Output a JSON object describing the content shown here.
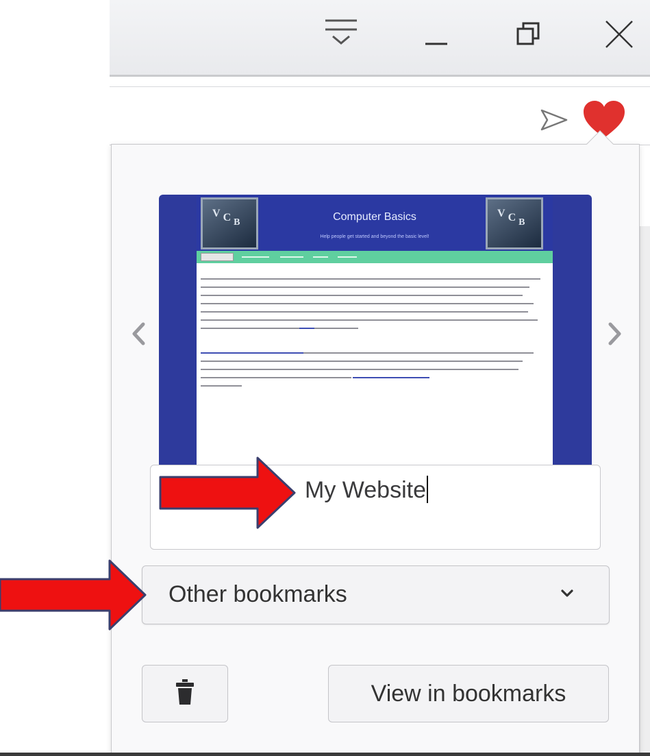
{
  "colors": {
    "accent_heart": "#e0312e",
    "annotation_arrow": "#ee1111",
    "thumbnail_frame": "#2e3a9c",
    "thumbnail_nav": "#5fcf9f"
  },
  "window_controls": {
    "overflow_icon": "overflow-menu-icon",
    "minimize_icon": "minimize-icon",
    "restore_icon": "restore-icon",
    "close_icon": "close-icon"
  },
  "toolbar": {
    "share_icon": "send-icon",
    "favorite_icon": "heart-icon"
  },
  "bookmark_popup": {
    "thumbnail": {
      "logo_text": [
        "V",
        "C",
        "B"
      ],
      "title": "Computer Basics",
      "subtitle": "Help people get started and beyond the basic level!"
    },
    "name_value": "My Website",
    "folder": {
      "selected": "Other bookmarks"
    },
    "delete_icon": "trash-icon",
    "view_button_label": "View in bookmarks"
  }
}
